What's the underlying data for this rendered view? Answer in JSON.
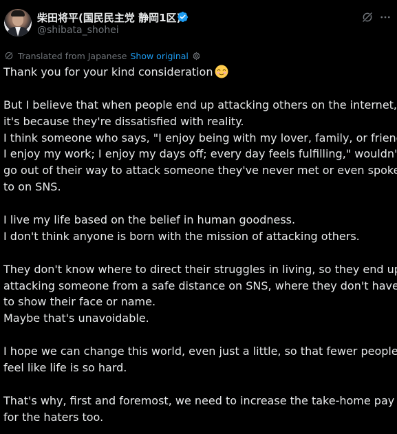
{
  "author": {
    "display_name": "柴田将平(国民民主党 静岡1区)",
    "handle": "@shibata_shohei",
    "verified": true,
    "verified_color": "#1d9bf0"
  },
  "header_actions": {
    "grok_icon": "grok-icon",
    "more_icon": "more-icon"
  },
  "translation": {
    "label": "Translated from Japanese",
    "link": "Show original",
    "settings_icon": "gear-icon"
  },
  "tweet": {
    "title_line": "Thank you for your kind consideration",
    "title_emoji": "☺️",
    "lines": [
      "",
      "But I believe that when people end up attacking others on the internet,",
      "it's because they're dissatisfied with reality.",
      "I think someone who says, \"I enjoy being with my lover, family, or friends;",
      "I enjoy my work; I enjoy my days off; every day feels fulfilling,\" wouldn't",
      "go out of their way to attack someone they've never met or even spoken",
      "to on SNS.",
      "",
      "I live my life based on the belief in human goodness.",
      "I don't think anyone is born with the mission of attacking others.",
      "",
      "They don't know where to direct their struggles in living, so they end up",
      "attacking someone from a safe distance on SNS, where they don't have",
      "to show their face or name.",
      "Maybe that's unavoidable.",
      "",
      "I hope we can change this world, even just a little, so that fewer people",
      "feel like life is so hard.",
      "",
      "That's why, first and foremost, we need to increase the take-home pay",
      "for the haters too."
    ]
  },
  "colors": {
    "background": "#000000",
    "text": "#e7e9ea",
    "secondary": "#71767b",
    "link": "#1d9bf0"
  }
}
